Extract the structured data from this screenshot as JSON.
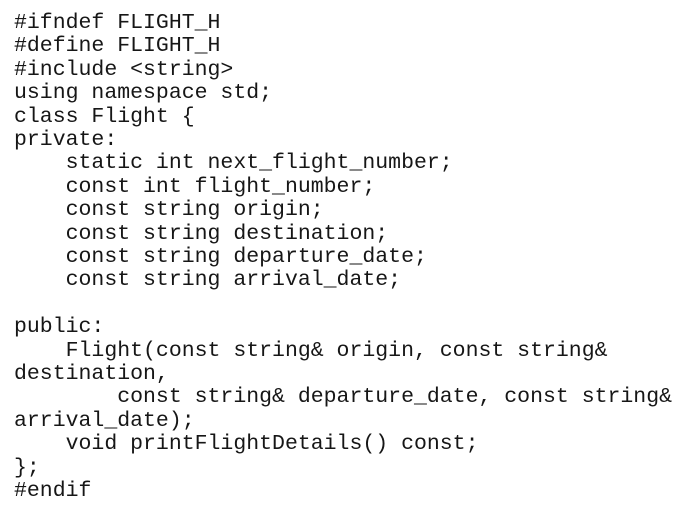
{
  "document": {
    "kind": "source-code-listing",
    "language": "C++",
    "file_title": "FLIGHT_H",
    "background_color": "#ffffff",
    "text_color": "#161616",
    "font_style": "monospace"
  },
  "code": {
    "lines": [
      "#ifndef FLIGHT_H",
      "#define FLIGHT_H",
      "#include <string>",
      "using namespace std;",
      "class Flight {",
      "private:",
      "    static int next_flight_number;",
      "    const int flight_number;",
      "    const string origin;",
      "    const string destination;",
      "    const string departure_date;",
      "    const string arrival_date;",
      "",
      "public:",
      "    Flight(const string& origin, const string& destination,",
      "        const string& departure_date, const string& arrival_date);",
      "    void printFlightDetails() const;",
      "};",
      "#endif"
    ]
  }
}
